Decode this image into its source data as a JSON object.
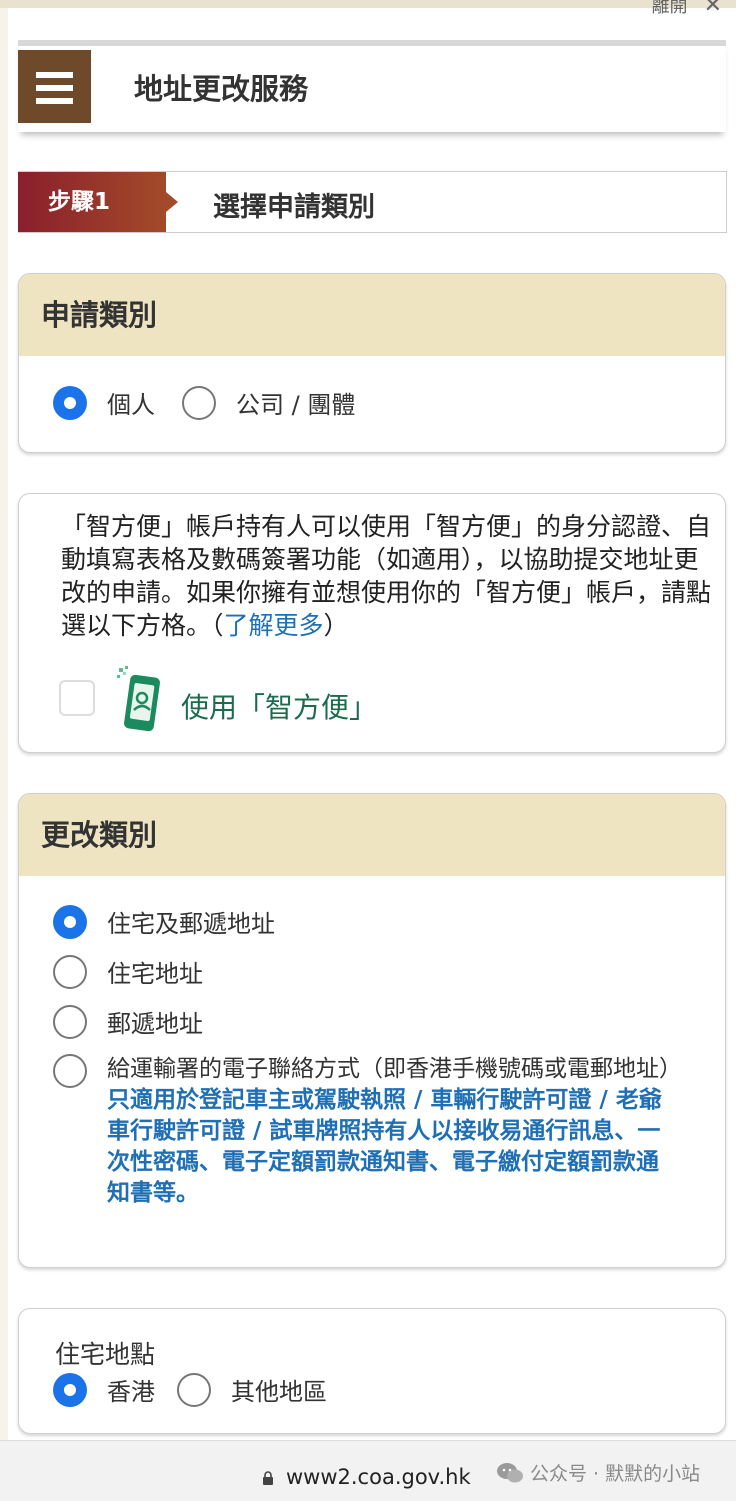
{
  "browser": {
    "close_label": "離開",
    "url": "www2.coa.gov.hk",
    "watermark": "公众号 · 默默的小站"
  },
  "header": {
    "title": "地址更改服務"
  },
  "step": {
    "badge": "步驟1",
    "title": "選擇申請類別"
  },
  "application_type": {
    "heading": "申請類別",
    "options": [
      {
        "label": "個人",
        "selected": true
      },
      {
        "label": "公司 / 團體",
        "selected": false
      }
    ]
  },
  "iam_smart": {
    "description": "「智方便」帳戶持有人可以使用「智方便」的身分認證、自動填寫表格及數碼簽署功能（如適用），以協助提交地址更改的申請。如果你擁有並想使用你的「智方便」帳戶，請點選以下方格。",
    "learn_more_open": "（",
    "learn_more": "了解更多",
    "learn_more_close": "）",
    "checkbox_label": "使用「智方便」",
    "checked": false
  },
  "change_type": {
    "heading": "更改類別",
    "options": [
      {
        "label": "住宅及郵遞地址",
        "selected": true
      },
      {
        "label": "住宅地址",
        "selected": false
      },
      {
        "label": "郵遞地址",
        "selected": false
      },
      {
        "label": "給運輸署的電子聯絡方式（即香港手機號碼或電郵地址）",
        "selected": false
      }
    ],
    "note": "只適用於登記車主或駕駛執照 / 車輛行駛許可證 / 老爺車行駛許可證 / 試車牌照持有人以接收易通行訊息、一次性密碼、電子定額罰款通知書、電子繳付定額罰款通知書等。"
  },
  "residential_location": {
    "title": "住宅地點",
    "options": [
      {
        "label": "香港",
        "selected": true
      },
      {
        "label": "其他地區",
        "selected": false
      }
    ]
  },
  "colors": {
    "accent_blue": "#1a73e8",
    "menu_brown": "#6f4a2a",
    "step_red": "#8a1f2c",
    "section_header": "#efe4c2",
    "iam_green": "#1b6b4d",
    "link_blue": "#1f6fb5"
  }
}
